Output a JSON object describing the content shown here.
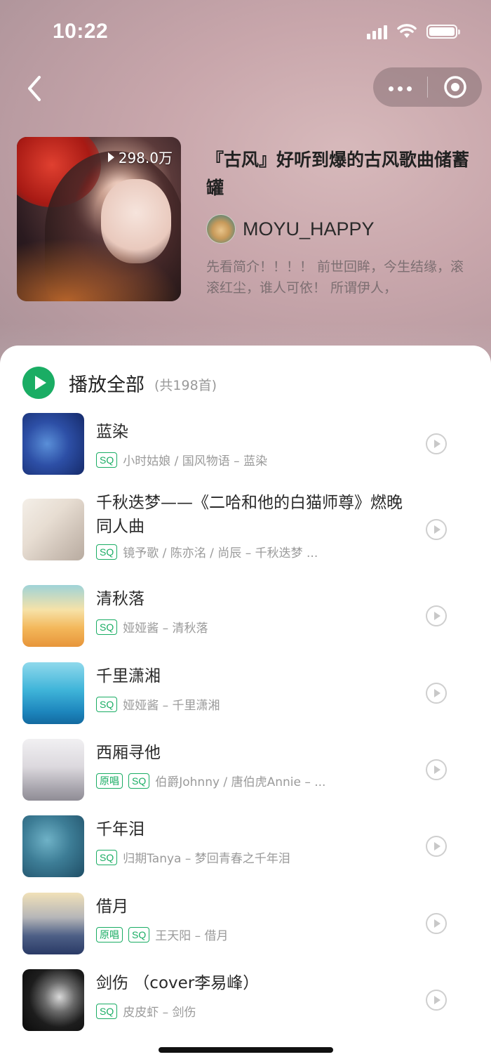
{
  "status_bar": {
    "time": "10:22"
  },
  "header": {
    "play_count": "298.0万",
    "title": "『古风』好听到爆的古风歌曲储蓄罐",
    "author": "MOYU_HAPPY",
    "description": "先看简介！！！！ 前世回眸，今生结缘，滚滚红尘，谁人可依！ 所谓伊人，"
  },
  "play_all": {
    "label": "播放全部",
    "count": "(共198首)"
  },
  "songs": [
    {
      "title": "蓝染",
      "badges": [
        "SQ"
      ],
      "meta": "小时姑娘 / 国风物语 – 蓝染"
    },
    {
      "title": "千秋迭梦——《二哈和他的白猫师尊》燃晚同人曲",
      "badges": [
        "SQ"
      ],
      "meta": "镜予歌 / 陈亦洺 / 尚辰 – 千秋迭梦 ..."
    },
    {
      "title": "清秋落",
      "badges": [
        "SQ"
      ],
      "meta": "娅娅酱 – 清秋落"
    },
    {
      "title": "千里潇湘",
      "badges": [
        "SQ"
      ],
      "meta": "娅娅酱 – 千里潇湘"
    },
    {
      "title": "西厢寻他",
      "badges": [
        "原唱",
        "SQ"
      ],
      "meta": "伯爵Johnny / 唐伯虎Annie – ..."
    },
    {
      "title": "千年泪",
      "badges": [
        "SQ"
      ],
      "meta": "归期Tanya – 梦回青春之千年泪"
    },
    {
      "title": "借月",
      "badges": [
        "原唱",
        "SQ"
      ],
      "meta": "王天阳 – 借月"
    },
    {
      "title": "剑伤 （cover李易峰）",
      "badges": [
        "SQ"
      ],
      "meta": "皮皮虾 – 剑伤"
    }
  ],
  "colors": {
    "accent": "#1aad64"
  }
}
